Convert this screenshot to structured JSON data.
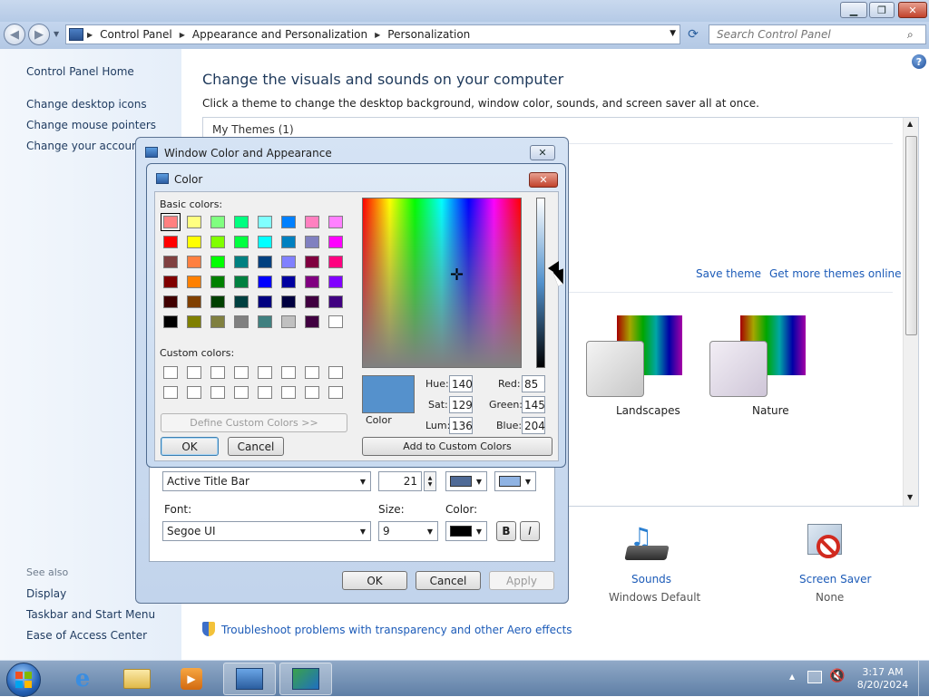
{
  "explorer": {
    "breadcrumbs": [
      "Control Panel",
      "Appearance and Personalization",
      "Personalization"
    ],
    "search_placeholder": "Search Control Panel",
    "help_glyph": "?"
  },
  "left_panel": {
    "home": "Control Panel Home",
    "links": [
      "Change desktop icons",
      "Change mouse pointers",
      "Change your account p"
    ],
    "see_also_heading": "See also",
    "see_also": [
      "Display",
      "Taskbar and Start Menu",
      "Ease of Access Center"
    ]
  },
  "main": {
    "title": "Change the visuals and sounds on your computer",
    "subtitle": "Click a theme to change the desktop background, window color, sounds, and screen saver all at once.",
    "my_themes": "My Themes (1)",
    "save_theme": "Save theme",
    "get_more": "Get more themes online",
    "themes": [
      "Landscapes",
      "Nature"
    ],
    "sounds_label": "Sounds",
    "sounds_value": "Windows Default",
    "screensaver_label": "Screen Saver",
    "screensaver_value": "None",
    "troubleshoot": "Troubleshoot problems with transparency and other Aero effects"
  },
  "wca_dialog": {
    "title": "Window Color and Appearance",
    "item_value": "Active Title Bar",
    "size_value": "21",
    "font_label": "Font:",
    "size_label": "Size:",
    "color_label": "Color:",
    "font_value": "Segoe UI",
    "font_size_value": "9",
    "bold": "B",
    "italic": "I",
    "ok": "OK",
    "cancel": "Cancel",
    "apply": "Apply",
    "color1": "#4f6a96",
    "color2": "#8fb3e3",
    "font_color": "#000000"
  },
  "color_dialog": {
    "title": "Color",
    "basic_colors_label": "Basic colors:",
    "custom_colors_label": "Custom colors:",
    "define_custom": "Define Custom Colors >>",
    "ok": "OK",
    "cancel": "Cancel",
    "add_custom": "Add to Custom Colors",
    "color_label": "Color",
    "hue_label": "Hue:",
    "sat_label": "Sat:",
    "lum_label": "Lum:",
    "red_label": "Red:",
    "green_label": "Green:",
    "blue_label": "Blue:",
    "hue": "140",
    "sat": "129",
    "lum": "136",
    "red": "85",
    "green": "145",
    "blue": "204",
    "preview_color": "#5591cc",
    "basic_colors": [
      "#ff8080",
      "#ffff80",
      "#80ff80",
      "#00ff80",
      "#80ffff",
      "#0080ff",
      "#ff80c0",
      "#ff80ff",
      "#ff0000",
      "#ffff00",
      "#80ff00",
      "#00ff40",
      "#00ffff",
      "#0080c0",
      "#8080c0",
      "#ff00ff",
      "#804040",
      "#ff8040",
      "#00ff00",
      "#008080",
      "#004080",
      "#8080ff",
      "#800040",
      "#ff0080",
      "#800000",
      "#ff8000",
      "#008000",
      "#008040",
      "#0000ff",
      "#0000a0",
      "#800080",
      "#8000ff",
      "#400000",
      "#804000",
      "#004000",
      "#004040",
      "#000080",
      "#000040",
      "#400040",
      "#400080",
      "#000000",
      "#808000",
      "#808040",
      "#808080",
      "#408080",
      "#c0c0c0",
      "#400040",
      "#ffffff"
    ]
  },
  "taskbar": {
    "time": "3:17 AM",
    "date": "8/20/2024"
  }
}
